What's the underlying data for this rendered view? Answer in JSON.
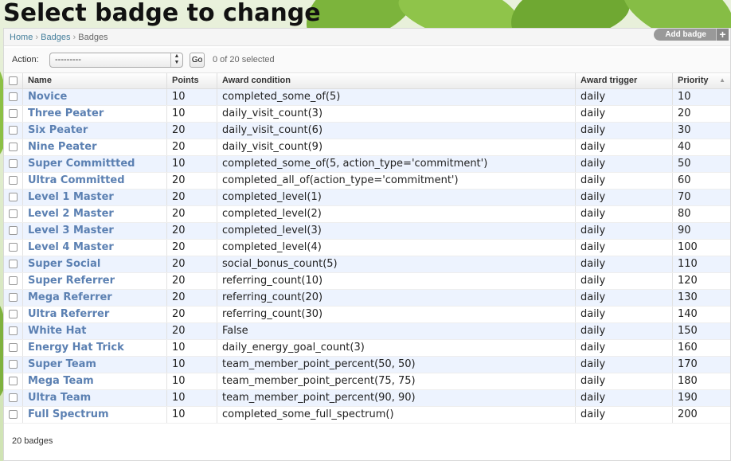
{
  "page": {
    "title": "Select badge to change"
  },
  "breadcrumb": {
    "home": "Home",
    "sep1": "›",
    "app": "Badges",
    "sep2": "›",
    "current": "Badges"
  },
  "object_tools": {
    "add_label": "Add badge",
    "add_icon": "+"
  },
  "actions": {
    "label": "Action:",
    "selected_value": "---------",
    "go_label": "Go",
    "counter": "0 of 20 selected"
  },
  "table": {
    "columns": [
      "Name",
      "Points",
      "Award condition",
      "Award trigger",
      "Priority"
    ],
    "rows": [
      {
        "name": "Novice",
        "points": "10",
        "condition": "completed_some_of(5)",
        "trigger": "daily",
        "priority": "10"
      },
      {
        "name": "Three Peater",
        "points": "10",
        "condition": "daily_visit_count(3)",
        "trigger": "daily",
        "priority": "20"
      },
      {
        "name": "Six Peater",
        "points": "20",
        "condition": "daily_visit_count(6)",
        "trigger": "daily",
        "priority": "30"
      },
      {
        "name": "Nine Peater",
        "points": "20",
        "condition": "daily_visit_count(9)",
        "trigger": "daily",
        "priority": "40"
      },
      {
        "name": "Super Committted",
        "points": "10",
        "condition": "completed_some_of(5, action_type='commitment')",
        "trigger": "daily",
        "priority": "50"
      },
      {
        "name": "Ultra Committed",
        "points": "20",
        "condition": "completed_all_of(action_type='commitment')",
        "trigger": "daily",
        "priority": "60"
      },
      {
        "name": "Level 1 Master",
        "points": "20",
        "condition": "completed_level(1)",
        "trigger": "daily",
        "priority": "70"
      },
      {
        "name": "Level 2 Master",
        "points": "20",
        "condition": "completed_level(2)",
        "trigger": "daily",
        "priority": "80"
      },
      {
        "name": "Level 3 Master",
        "points": "20",
        "condition": "completed_level(3)",
        "trigger": "daily",
        "priority": "90"
      },
      {
        "name": "Level 4 Master",
        "points": "20",
        "condition": "completed_level(4)",
        "trigger": "daily",
        "priority": "100"
      },
      {
        "name": "Super Social",
        "points": "20",
        "condition": "social_bonus_count(5)",
        "trigger": "daily",
        "priority": "110"
      },
      {
        "name": "Super Referrer",
        "points": "20",
        "condition": "referring_count(10)",
        "trigger": "daily",
        "priority": "120"
      },
      {
        "name": "Mega Referrer",
        "points": "20",
        "condition": "referring_count(20)",
        "trigger": "daily",
        "priority": "130"
      },
      {
        "name": "Ultra Referrer",
        "points": "20",
        "condition": "referring_count(30)",
        "trigger": "daily",
        "priority": "140"
      },
      {
        "name": "White Hat",
        "points": "20",
        "condition": "False",
        "trigger": "daily",
        "priority": "150"
      },
      {
        "name": "Energy Hat Trick",
        "points": "10",
        "condition": "daily_energy_goal_count(3)",
        "trigger": "daily",
        "priority": "160"
      },
      {
        "name": "Super Team",
        "points": "10",
        "condition": "team_member_point_percent(50, 50)",
        "trigger": "daily",
        "priority": "170"
      },
      {
        "name": "Mega Team",
        "points": "10",
        "condition": "team_member_point_percent(75, 75)",
        "trigger": "daily",
        "priority": "180"
      },
      {
        "name": "Ultra Team",
        "points": "10",
        "condition": "team_member_point_percent(90, 90)",
        "trigger": "daily",
        "priority": "190"
      },
      {
        "name": "Full Spectrum",
        "points": "10",
        "condition": "completed_some_full_spectrum()",
        "trigger": "daily",
        "priority": "200"
      }
    ]
  },
  "paginator": {
    "text": "20 badges"
  },
  "icons": {
    "sort": "sort-ascending-icon",
    "select_arrows": "select-arrows-icon",
    "add": "plus-icon"
  },
  "colors": {
    "link": "#5b80b2",
    "row_alt": "#edf3fe",
    "breadcrumb_link": "#447e9b"
  }
}
